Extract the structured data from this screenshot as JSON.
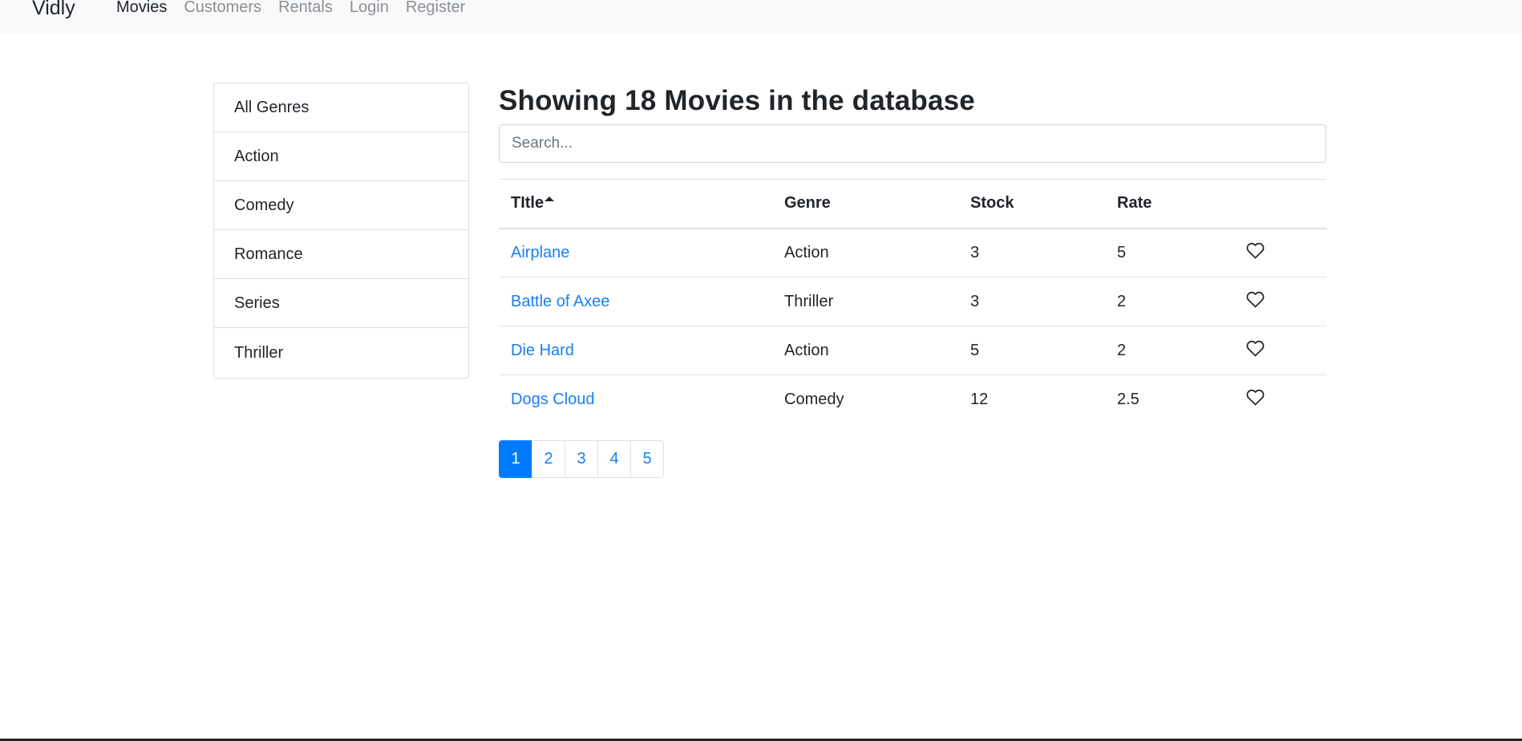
{
  "navbar": {
    "brand": "Vidly",
    "links": [
      {
        "label": "Movies",
        "active": true
      },
      {
        "label": "Customers",
        "active": false
      },
      {
        "label": "Rentals",
        "active": false
      },
      {
        "label": "Login",
        "active": false
      },
      {
        "label": "Register",
        "active": false
      }
    ]
  },
  "genres": [
    "All Genres",
    "Action",
    "Comedy",
    "Romance",
    "Series",
    "Thriller"
  ],
  "main": {
    "heading": "Showing 18 Movies in the database",
    "search_placeholder": "Search...",
    "search_value": ""
  },
  "table": {
    "headers": [
      "TItle",
      "Genre",
      "Stock",
      "Rate"
    ],
    "sorted_column": "TItle",
    "sort_direction": "asc",
    "rows": [
      {
        "title": "Airplane",
        "genre": "Action",
        "stock": "3",
        "rate": "5",
        "like_icon": "heart-outline-icon"
      },
      {
        "title": "Battle of Axee",
        "genre": "Thriller",
        "stock": "3",
        "rate": "2",
        "like_icon": "heart-outline-icon"
      },
      {
        "title": "Die Hard",
        "genre": "Action",
        "stock": "5",
        "rate": "2",
        "like_icon": "heart-outline-icon"
      },
      {
        "title": "Dogs Cloud",
        "genre": "Comedy",
        "stock": "12",
        "rate": "2.5",
        "like_icon": "heart-outline-icon"
      }
    ]
  },
  "pagination": {
    "pages": [
      "1",
      "2",
      "3",
      "4",
      "5"
    ],
    "current": "1"
  },
  "colors": {
    "navbar_bg": "#f8f9fa",
    "link": "#1a7ff0",
    "active_page": "#007bff"
  }
}
